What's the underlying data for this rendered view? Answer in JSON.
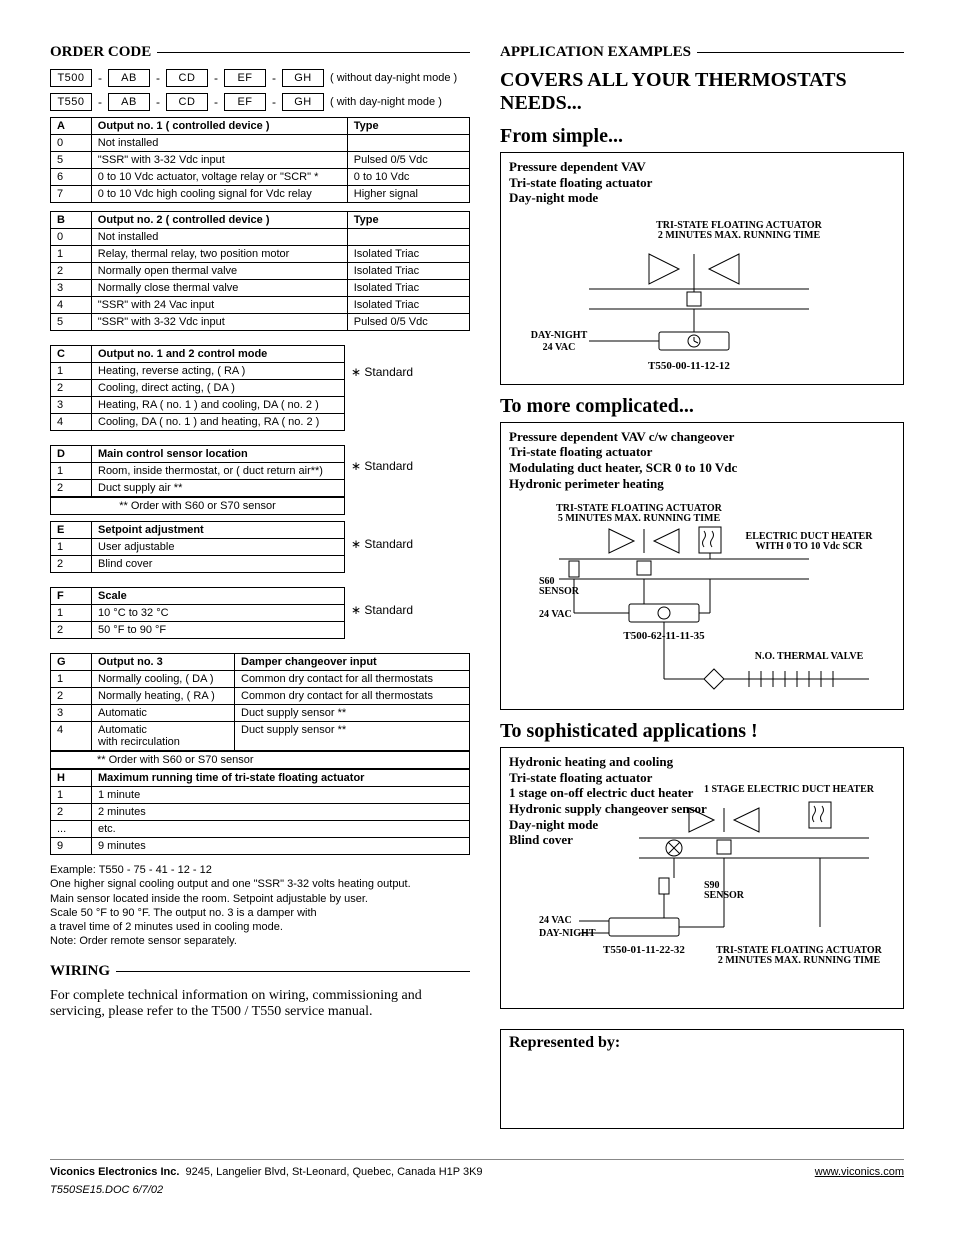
{
  "left": {
    "order_code_heading": "ORDER CODE",
    "row1": {
      "boxes": [
        "T500",
        "AB",
        "CD",
        "EF",
        "GH"
      ],
      "note": "( without day-night mode )"
    },
    "row2": {
      "boxes": [
        "T550",
        "AB",
        "CD",
        "EF",
        "GH"
      ],
      "note": "( with day-night mode )"
    },
    "tableA": {
      "head": [
        "A",
        "Output no. 1 ( controlled device )",
        "Type"
      ],
      "rows": [
        [
          "0",
          "Not installed",
          ""
        ],
        [
          "5",
          "\"SSR\" with 3-32 Vdc input",
          "Pulsed 0/5 Vdc"
        ],
        [
          "6",
          "0 to 10 Vdc actuator, voltage relay or \"SCR\" *",
          "0 to 10 Vdc"
        ],
        [
          "7",
          "0 to 10 Vdc high cooling signal for Vdc relay",
          "Higher signal"
        ]
      ]
    },
    "tableB": {
      "head": [
        "B",
        "Output no. 2 ( controlled device )",
        "Type"
      ],
      "rows": [
        [
          "0",
          "Not installed",
          ""
        ],
        [
          "1",
          "Relay, thermal relay, two position motor",
          "Isolated  Triac"
        ],
        [
          "2",
          "Normally open thermal valve",
          "Isolated  Triac"
        ],
        [
          "3",
          "Normally close thermal valve",
          "Isolated  Triac"
        ],
        [
          "4",
          "\"SSR\" with 24 Vac input",
          "Isolated  Triac"
        ],
        [
          "5",
          "\"SSR\" with 3-32 Vdc input",
          "Pulsed 0/5 Vdc"
        ]
      ]
    },
    "tableC": {
      "head": [
        "C",
        "Output no. 1 and 2 control mode"
      ],
      "rows": [
        [
          "1",
          "Heating,  reverse acting,  ( RA )"
        ],
        [
          "2",
          "Cooling,  direct acting,    ( DA )"
        ],
        [
          "3",
          "Heating, RA ( no. 1 ) and cooling, DA ( no. 2 )"
        ],
        [
          "4",
          "Cooling, DA ( no. 1 ) and heating, RA ( no. 2 )"
        ]
      ],
      "std": "∗ Standard"
    },
    "tableD": {
      "head": [
        "D",
        "Main control sensor location"
      ],
      "rows": [
        [
          "1",
          "Room, inside thermostat, or ( duct return air**)"
        ],
        [
          "2",
          "Duct supply air **"
        ]
      ],
      "note": "**  Order with S60 or S70 sensor",
      "std": "∗ Standard"
    },
    "tableE": {
      "head": [
        "E",
        "Setpoint adjustment"
      ],
      "rows": [
        [
          "1",
          "User adjustable"
        ],
        [
          "2",
          "Blind cover"
        ]
      ],
      "std": "∗ Standard"
    },
    "tableF": {
      "head": [
        "F",
        "Scale"
      ],
      "rows": [
        [
          "1",
          "10 °C to 32 °C"
        ],
        [
          "2",
          "50 °F to 90 °F"
        ]
      ],
      "std": "∗ Standard"
    },
    "tableG": {
      "head": [
        "G",
        "Output no. 3",
        "Damper changeover input"
      ],
      "rows": [
        [
          "1",
          "Normally cooling,  ( DA )",
          "Common dry contact for all thermostats"
        ],
        [
          "2",
          "Normally heating,  ( RA )",
          "Common dry contact for all thermostats"
        ],
        [
          "3",
          "Automatic",
          "Duct supply sensor  **"
        ],
        [
          "4",
          "Automatic\nwith recirculation",
          "Duct supply sensor  **"
        ]
      ],
      "note": "**   Order with S60 or S70 sensor"
    },
    "tableH": {
      "head": [
        "H",
        "Maximum running time of tri-state floating actuator"
      ],
      "rows": [
        [
          "1",
          "1 minute"
        ],
        [
          "2",
          "2 minutes"
        ],
        [
          "...",
          "etc."
        ],
        [
          "9",
          "9 minutes"
        ]
      ]
    },
    "example": [
      "Example:  T550 - 75 - 41 - 12 - 12",
      "One higher signal cooling output and one \"SSR\" 3-32 volts heating output.",
      "Main sensor located inside the room. Setpoint adjustable by user.",
      "Scale 50 °F to 90 °F. The output no. 3 is a damper with",
      "a travel time of 2 minutes used in cooling mode.",
      "Note: Order remote sensor separately."
    ],
    "wiring_heading": "WIRING",
    "wiring_text": "For complete technical information on wiring, commissioning and servicing, please refer to the T500 / T550 service manual."
  },
  "right": {
    "app_examples_heading": "APPLICATION EXAMPLES",
    "headline": "COVERS ALL YOUR THERMOSTATS NEEDS...",
    "simple": {
      "title": "From simple...",
      "lines": [
        "Pressure dependent VAV",
        "Tri-state floating actuator",
        "Day-night mode"
      ],
      "diag_top": "TRI-STATE FLOATING ACTUATOR\n2 MINUTES MAX. RUNNING TIME",
      "left_labels": [
        "DAY-NIGHT",
        "24 VAC"
      ],
      "model": "T550-00-11-12-12"
    },
    "complicated": {
      "title": "To more complicated...",
      "lines": [
        "Pressure dependent VAV c/w changeover",
        "Tri-state floating actuator",
        "Modulating duct heater, SCR 0 to 10 Vdc",
        "Hydronic perimeter heating"
      ],
      "diag_top": "TRI-STATE FLOATING ACTUATOR\n5 MINUTES MAX. RUNNING TIME",
      "right_label": "ELECTRIC DUCT HEATER\nWITH 0 TO 10 Vdc SCR",
      "left_labels": [
        "S60\nSENSOR",
        "24 VAC"
      ],
      "model": "T500-62-11-11-35",
      "bottom_label": "N.O. THERMAL VALVE"
    },
    "sophisticated": {
      "title": "To sophisticated applications !",
      "lines": [
        "Hydronic heating and cooling",
        "Tri-state floating actuator",
        "1 stage on-off electric duct heater",
        "Hydronic supply changeover sensor",
        "Day-night mode",
        "Blind cover"
      ],
      "diag_top": "1 STAGE ELECTRIC DUCT HEATER",
      "sensor": "S90\nSENSOR",
      "left_labels": [
        "24 VAC",
        "DAY-NIGHT"
      ],
      "model": "T550-01-11-22-32",
      "bottom_label": "TRI-STATE FLOATING ACTUATOR\n2 MINUTES MAX. RUNNING TIME"
    },
    "represented_by": "Represented by:"
  },
  "footer": {
    "company": "Viconics Electronics Inc.",
    "address": "9245, Langelier Blvd, St-Leonard, Quebec, Canada H1P 3K9",
    "url": "www.viconics.com",
    "docid": "T550SE15.DOC  6/7/02"
  }
}
